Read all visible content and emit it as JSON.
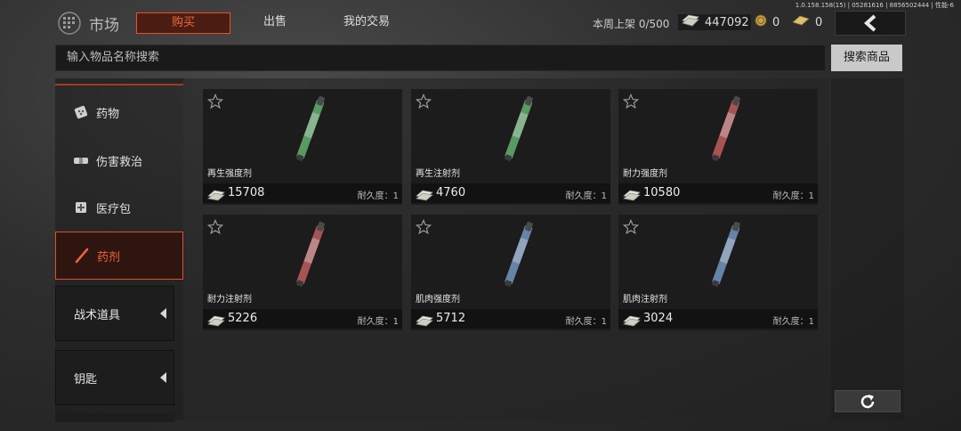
{
  "version": "1.0.158.158(15) | 05281616 | 8856502444 | 性能-6",
  "header": {
    "title": "市场",
    "tabs": [
      {
        "label": "购买",
        "active": true
      },
      {
        "label": "出售",
        "active": false
      },
      {
        "label": "我的交易",
        "active": false
      }
    ],
    "weekly_listing": "本周上架 0/500",
    "currency": {
      "cash": "447092",
      "coin": "0",
      "bond": "0"
    }
  },
  "search": {
    "placeholder": "输入物品名称搜索",
    "button": "搜索商品"
  },
  "sidebar": {
    "items": [
      {
        "label": "药物",
        "icon": "pills-icon"
      },
      {
        "label": "伤害救治",
        "icon": "bandage-icon"
      },
      {
        "label": "医疗包",
        "icon": "medkit-icon"
      },
      {
        "label": "药剂",
        "icon": "syringe-icon",
        "active": true
      }
    ],
    "groups": [
      {
        "label": "战术道具"
      },
      {
        "label": "钥匙"
      }
    ]
  },
  "products": [
    {
      "name": "再生强度剂",
      "price": "15708",
      "durability": "耐久度：1",
      "color": "#5fa86a"
    },
    {
      "name": "再生注射剂",
      "price": "4760",
      "durability": "耐久度：1",
      "color": "#5fa86a"
    },
    {
      "name": "耐力强度剂",
      "price": "10580",
      "durability": "耐久度：1",
      "color": "#b85a5a"
    },
    {
      "name": "耐力注射剂",
      "price": "5226",
      "durability": "耐久度：1",
      "color": "#b85a5a"
    },
    {
      "name": "肌肉强度剂",
      "price": "5712",
      "durability": "耐久度：1",
      "color": "#6f8fb8"
    },
    {
      "name": "肌肉注射剂",
      "price": "3024",
      "durability": "耐久度：1",
      "color": "#6f8fb8"
    }
  ],
  "colors": {
    "accent": "#e0502c",
    "accent_text": "#f06a3a"
  }
}
